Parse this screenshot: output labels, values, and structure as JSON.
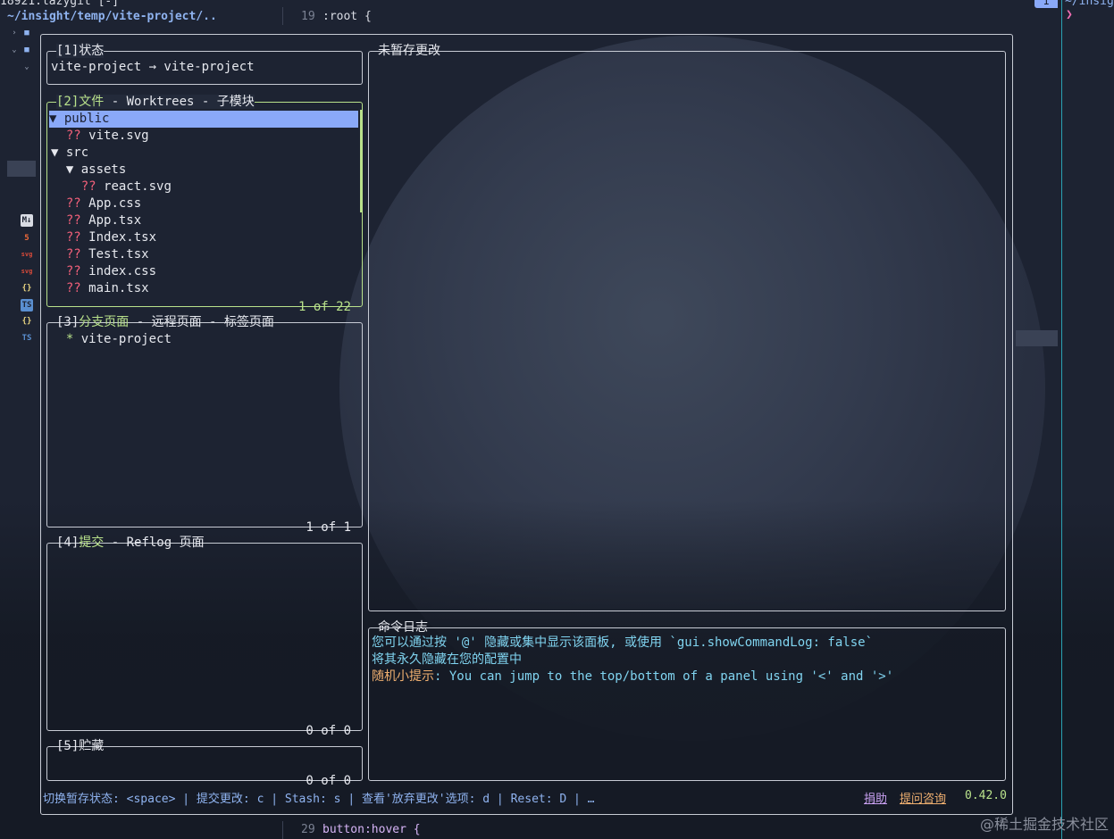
{
  "terminal": {
    "title": "18921.lazygit [-]",
    "path": "~/insight/temp/vite-project/..",
    "editor_top": {
      "line": "19",
      "code": ":root {"
    },
    "editor_bottom": {
      "line": "29",
      "code": "button:hover {"
    },
    "right_tab_number": "1",
    "right_path": "~/insig",
    "right_marker": "❯"
  },
  "sidebar_icons": [
    {
      "name": "chevron-right-icon",
      "glyph": "›"
    },
    {
      "name": "folder-icon",
      "glyph": "▰"
    },
    {
      "name": "chevron-down-icon",
      "glyph": "⌄"
    },
    {
      "name": "folder-open-icon",
      "glyph": "▰"
    },
    {
      "name": "chevron-down-icon",
      "glyph": "⌄"
    },
    {
      "name": "markdown-icon",
      "glyph": "M↓"
    },
    {
      "name": "html-icon",
      "glyph": "5"
    },
    {
      "name": "svg-icon",
      "glyph": "svg"
    },
    {
      "name": "svg-icon",
      "glyph": "svg"
    },
    {
      "name": "json-icon",
      "glyph": "{}"
    },
    {
      "name": "typescript-icon",
      "glyph": "TS"
    },
    {
      "name": "json-icon",
      "glyph": "{}"
    },
    {
      "name": "typescript-icon",
      "glyph": "TS"
    }
  ],
  "panels": {
    "status": {
      "title_num": "[1]",
      "title": "状态",
      "content": "vite-project → vite-project"
    },
    "files": {
      "title_num": "[2]",
      "title_active": "文件",
      "title_rest": " - Worktrees - 子模块",
      "footer": "1 of 22",
      "rows": [
        {
          "indent": "",
          "marker": "▼ ",
          "status": "",
          "name": "public"
        },
        {
          "indent": "  ",
          "marker": "",
          "status": "?? ",
          "name": "vite.svg"
        },
        {
          "indent": "",
          "marker": "▼ ",
          "status": "",
          "name": "src"
        },
        {
          "indent": "  ",
          "marker": "▼ ",
          "status": "",
          "name": "assets"
        },
        {
          "indent": "    ",
          "marker": "",
          "status": "?? ",
          "name": "react.svg"
        },
        {
          "indent": "  ",
          "marker": "",
          "status": "?? ",
          "name": "App.css"
        },
        {
          "indent": "  ",
          "marker": "",
          "status": "?? ",
          "name": "App.tsx"
        },
        {
          "indent": "  ",
          "marker": "",
          "status": "?? ",
          "name": "Index.tsx"
        },
        {
          "indent": "  ",
          "marker": "",
          "status": "?? ",
          "name": "Test.tsx"
        },
        {
          "indent": "  ",
          "marker": "",
          "status": "?? ",
          "name": "index.css"
        },
        {
          "indent": "  ",
          "marker": "",
          "status": "?? ",
          "name": "main.tsx"
        }
      ]
    },
    "branches": {
      "title_num": "[3]",
      "title_active": "分支页面",
      "title_rest": " - 远程页面 - 标签页面",
      "footer": "1 of 1",
      "item_marker": "*",
      "item": "vite-project"
    },
    "commits": {
      "title_num": "[4]",
      "title_active": "提交",
      "title_rest": " - Reflog 页面",
      "footer": "0 of 0"
    },
    "stash": {
      "title_num": "[5]",
      "title": "贮藏",
      "footer": "0 of 0"
    },
    "unstaged": {
      "title": "未暂存更改"
    },
    "command_log": {
      "title": "命令日志",
      "line1": "您可以通过按 '@' 隐藏或集中显示该面板, 或使用 `gui.showCommandLog: false`",
      "line2": "将其永久隐藏在您的配置中",
      "tip_label": "随机小提示",
      "tip_text": ": You can jump to the top/bottom of a panel using '<' and '>'"
    }
  },
  "helpbar": {
    "keys": "切换暂存状态: <space> | 提交更改: c | Stash: s | 查看'放弃更改'选项: d | Reset: D | …",
    "donate": "捐助",
    "ask": "提问咨询",
    "version": "0.42.0"
  },
  "watermark": "@稀土掘金技术社区",
  "colors": {
    "active_border": "#b9e28b",
    "selection": "#8aa9f8",
    "untracked": "#f2607a",
    "accent_blue": "#8fb3f0"
  }
}
